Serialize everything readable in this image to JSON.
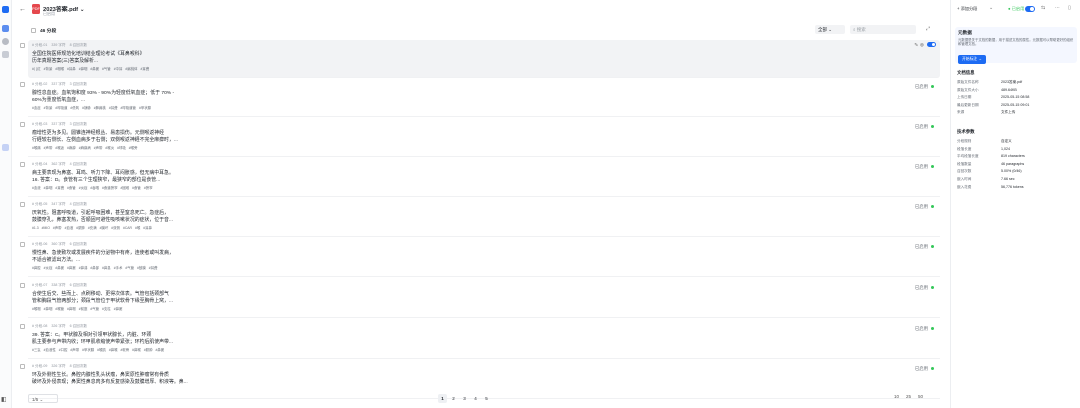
{
  "header": {
    "back": "←",
    "file_icon": "PDF",
    "file_name": "2023答案.pdf ⌄",
    "file_sub": "已启用"
  },
  "toolbar": {
    "count": "46 分段",
    "filter_value": "全部     ⌄",
    "search_placeholder": "⌕ 搜索",
    "expand_icon": "⤢"
  },
  "segments": [
    {
      "meta": [
        "# 分段-01",
        "339 字符",
        "8 召回次数"
      ],
      "line1": "全国住院医师规范化培训结业理论考试《耳鼻喉科》",
      "line2": "历年真题答案(三)答案及解析...",
      "tags": [
        "#儿红",
        "#背景",
        "#咽喉",
        "#耳鼻",
        "#鼻咽",
        "#鼻窦",
        "#气管",
        "#中耳",
        "#扁桃体",
        "#耳聋"
      ],
      "status": ""
    },
    {
      "meta": [
        "# 分段-02",
        "337 字符",
        "3 召回次数"
      ],
      "line1": "腺性息血症。血氧饱和度 93% - 90%为轻度低氧血症；低于 70% -",
      "line2": "60%为重度低氧血症，...",
      "tags": [
        "#血症",
        "#背景",
        "#呼吸道",
        "#低氧",
        "#静脉",
        "#肺扁桃",
        "#耳聋",
        "#呼吸道管",
        "#甲状腺"
      ],
      "status": "已启用"
    },
    {
      "meta": [
        "# 分段-03",
        "337 字符",
        "3 召回次数"
      ],
      "line1": "瘤增性更为多见。圆锥连神经根丛、易患损伤。元側喉返神经",
      "line2": "行経较右側长、左側血病多于右側；双側喉返神経不完全麻痹时，...",
      "tags": [
        "#喉痛",
        "#声带",
        "#喉返",
        "#麻痹",
        "#麻痹病",
        "#声带",
        "#喉炎",
        "#呼吸",
        "#喉旁"
      ],
      "status": "已启用"
    },
    {
      "meta": [
        "# 分段-04",
        "362 字符",
        "4 召回次数"
      ],
      "line1": "病主要表现为鼻塞、耳鸣、听力下降、耳闷胀感，但无病中耳急。",
      "line2": "16. 答案：D。食管有三个生理狭窄，最狭窄的部位是食管...",
      "tags": [
        "#血液",
        "#鼻咽",
        "#耳聋",
        "#食管",
        "#炎症",
        "#吞咽",
        "#食道狭窄",
        "#困难",
        "#食管",
        "#狭窄"
      ],
      "status": "已启用"
    },
    {
      "meta": [
        "# 分段-05",
        "347 字符",
        "4 召回次数"
      ],
      "line1": "厌氧性。阻塞呼吸道，引起呼吸困难，甚至窒息死亡。急症后，",
      "line2": "鼓膜穿孔，鼻塞发热，否順固可避性吸咳嗽状况的症状，位于音...",
      "tags": [
        "#1.3",
        "#MIO",
        "#声带",
        "#血液",
        "#脓肿",
        "#充满",
        "#膜坏",
        "#双侧",
        "#CAR",
        "#喉",
        "#耳鼻"
      ],
      "status": "已启用"
    },
    {
      "meta": [
        "# 分段-06",
        "360 字符",
        "6 召回次数"
      ],
      "line1": "慢性鼻、急使致坎或发展疾件的分泌物中有疼，连使者或叫发病，",
      "line2": "不适合被滤出方法。...",
      "tags": [
        "#鼻腔",
        "#炎症",
        "#鼻窦",
        "#鼻窦",
        "#鼻涕",
        "#鼻部",
        "#鼻息",
        "#手术",
        "#气管",
        "#鼓膜",
        "#耳聋"
      ],
      "status": "已启用"
    },
    {
      "meta": [
        "# 分段-07",
        "338 字符",
        "6 召回次数"
      ],
      "line1": "合使生后交、些而上、点刷移动、更得次体表。气管包括颈部气",
      "line2": "管和胸段气管两部分；颈段气管位于甲状软骨下缘至胸骨上窝，...",
      "tags": [
        "#喉咽",
        "#鼻咽",
        "#喉管",
        "#鼻咽",
        "#前庭",
        "#气管",
        "#支柱",
        "#鼻窦"
      ],
      "status": "已启用"
    },
    {
      "meta": [
        "# 分段-08",
        "326 字符",
        "6 召回次数"
      ],
      "line1": "39. 答案：C。甲状腺及相对引领甲状腺长，内脏、环颈",
      "line2": "        肌主要参与声带内收；环甲肌收缩使声带紧张；环杓后肌使声带...",
      "tags": [
        "#三氢",
        "#血液性",
        "#口腔",
        "#声带",
        "#甲状腺",
        "#喉肌",
        "#鼻喉",
        "#软骨",
        "#鼻喉",
        "#脓肿",
        "#鼻窦"
      ],
      "status": "已启用"
    },
    {
      "meta": [
        "# 分段-09",
        "326 字符",
        "8 召回次数"
      ],
      "line1": "环及外侧性生长。鼻腔内腺性乳头状瘤，鼻窦原性肿瘤常有骨质",
      "line2": "破坏及外侵表现；鼻窦性鼻息肉多有反复感染及鼓膜增厚、积液等。鼻...",
      "tags": [],
      "status": "已启用"
    }
  ],
  "row_actions": {
    "edit": "✎",
    "delete": "⊗"
  },
  "pager": {
    "page_box": "1/5  ⌄",
    "pages": [
      "1",
      "2",
      "3",
      "4",
      "5"
    ],
    "current": "1",
    "sizes": [
      "10",
      "25",
      "50"
    ]
  },
  "right": {
    "add_segment": "+ 添加分段",
    "enabled": "● 已启用",
    "meta_box_title": "元数据",
    "meta_box_desc": "元数据是关于文档的数据，用于描述文档的属性。元数据可以帮助更好的组织和管理文档。",
    "meta_box_button": "开始标注 →",
    "doc_info_title": "文档信息",
    "doc_info": [
      {
        "k": "原始文件名称",
        "v": "2023答案.pdf"
      },
      {
        "k": "原始文件大小",
        "v": "489.64KB"
      },
      {
        "k": "上传日期",
        "v": "2025-05-15 08:58"
      },
      {
        "k": "最后更新日期",
        "v": "2025-05-15 09:01"
      },
      {
        "k": "来源",
        "v": "文件上传"
      }
    ],
    "tech_title": "技术参数",
    "tech": [
      {
        "k": "分段规则",
        "v": "自定义"
      },
      {
        "k": "段落长度",
        "v": "1,024"
      },
      {
        "k": "平均段落长度",
        "v": "819 characters"
      },
      {
        "k": "段落数量",
        "v": "46 paragraphs"
      },
      {
        "k": "召回次数",
        "v": "5.00% (0/46)"
      },
      {
        "k": "嵌入时间",
        "v": "7.66 sec"
      },
      {
        "k": "嵌入花费",
        "v": "56,776 tokens"
      }
    ]
  }
}
